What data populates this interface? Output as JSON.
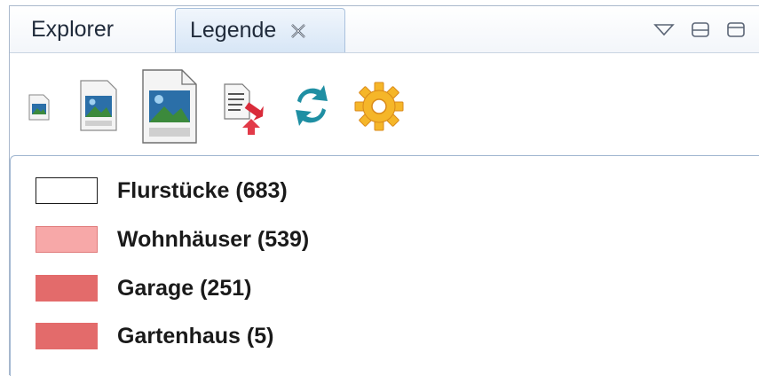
{
  "tabs": [
    {
      "label": "Explorer",
      "active": false
    },
    {
      "label": "Legende",
      "active": true
    }
  ],
  "window_controls": [
    "view-menu-icon",
    "minimize-icon",
    "maximize-icon"
  ],
  "toolbar": {
    "buttons": [
      {
        "icon": "small-image-icon",
        "tooltip": ""
      },
      {
        "icon": "medium-image-icon",
        "tooltip": ""
      },
      {
        "icon": "large-image-icon",
        "tooltip": ""
      },
      {
        "icon": "export-document-icon",
        "tooltip": ""
      },
      {
        "icon": "refresh-icon",
        "tooltip": ""
      },
      {
        "icon": "settings-gear-icon",
        "tooltip": ""
      }
    ]
  },
  "legend": {
    "items": [
      {
        "label": "Flurstücke (683)",
        "fill": "#ffffff",
        "border": "#1a1a1a"
      },
      {
        "label": "Wohnhäuser (539)",
        "fill": "#f7a8a8",
        "border": "#e07a7a"
      },
      {
        "label": "Garage (251)",
        "fill": "#e36b6b",
        "border": "#e36b6b"
      },
      {
        "label": "Gartenhaus (5)",
        "fill": "#e36b6b",
        "border": "#e36b6b"
      }
    ]
  },
  "colors": {
    "tab_active_bg": "#d7e6f6",
    "frame_border": "#a9b8cc",
    "refresh_teal": "#1f8fa3",
    "gear_orange": "#f5a623"
  }
}
